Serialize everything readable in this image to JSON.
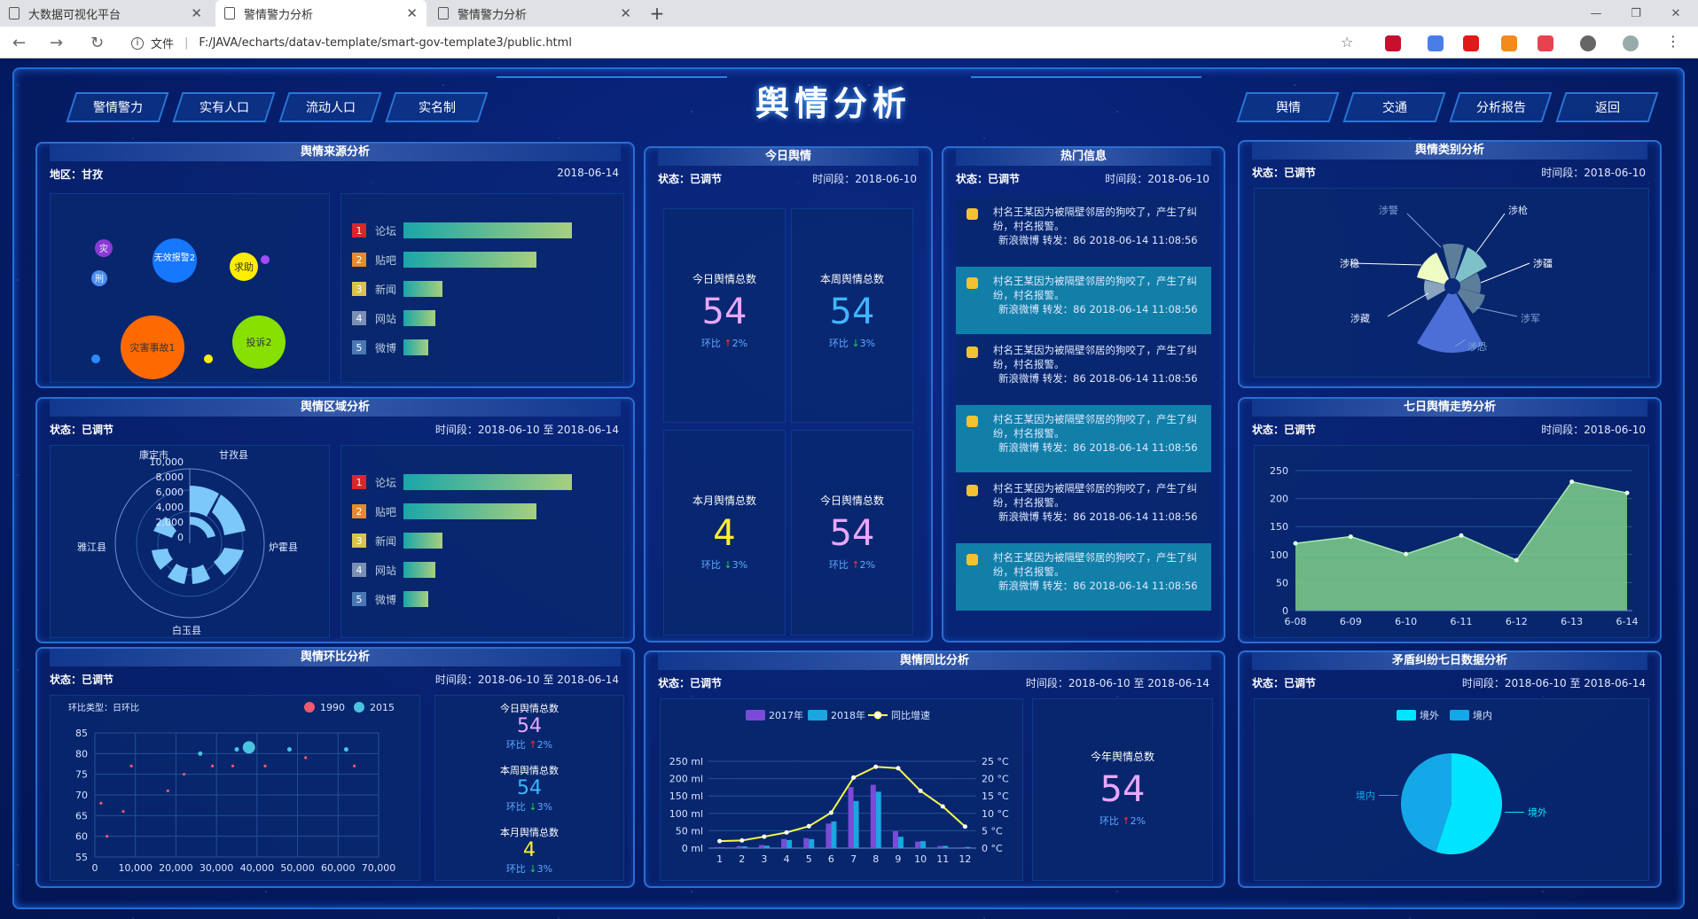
{
  "browser": {
    "tabs": [
      {
        "label": "大数据可视化平台"
      },
      {
        "label": "警情警力分析"
      },
      {
        "label": "警情警力分析"
      }
    ],
    "file_label": "文件",
    "url": "F:/JAVA/echarts/datav-template/smart-gov-template3/public.html"
  },
  "page": {
    "title": "舆情分析",
    "nav_left": [
      "警情警力",
      "实有人口",
      "流动人口",
      "实名制"
    ],
    "nav_right": [
      "舆情",
      "交通",
      "分析报告",
      "返回"
    ]
  },
  "source_panel": {
    "title": "舆情来源分析",
    "region": "地区：甘孜",
    "date": "2018-06-14",
    "bubbles": [
      {
        "label": "灾",
        "color": "#8a3bd6"
      },
      {
        "label": "无效报警2",
        "color": "#1677ff"
      },
      {
        "label": "求助",
        "color": "#ffee00"
      },
      {
        "label": "刑",
        "color": "#4e8ef5"
      },
      {
        "label": "灾害事故1",
        "color": "#ff6a00"
      },
      {
        "label": "投诉2",
        "color": "#88e000"
      }
    ],
    "ranks": [
      {
        "rank": "1",
        "name": "论坛",
        "value": 0.95,
        "color": "#d8262d"
      },
      {
        "rank": "2",
        "name": "贴吧",
        "value": 0.75,
        "color": "#e88a2a"
      },
      {
        "rank": "3",
        "name": "新闻",
        "value": 0.22,
        "color": "#d8c44a"
      },
      {
        "rank": "4",
        "name": "网站",
        "value": 0.18,
        "color": "#7a8fb5"
      },
      {
        "rank": "5",
        "name": "微博",
        "value": 0.14,
        "color": "#4a78b5"
      }
    ]
  },
  "region_panel": {
    "title": "舆情区域分析",
    "status": "状态：已调节",
    "period": "时间段：2018-06-10 至 2018-06-14",
    "radial_labels": [
      "康定市",
      "甘孜县",
      "雅江县",
      "炉霍县",
      "白玉县"
    ],
    "radial_ticks": [
      "10,000",
      "8,000",
      "6,000",
      "4,000",
      "2,000",
      "0"
    ],
    "ranks": [
      {
        "rank": "1",
        "name": "论坛",
        "value": 0.95,
        "color": "#d8262d"
      },
      {
        "rank": "2",
        "name": "贴吧",
        "value": 0.75,
        "color": "#e88a2a"
      },
      {
        "rank": "3",
        "name": "新闻",
        "value": 0.22,
        "color": "#d8c44a"
      },
      {
        "rank": "4",
        "name": "网站",
        "value": 0.18,
        "color": "#7a8fb5"
      },
      {
        "rank": "5",
        "name": "微博",
        "value": 0.14,
        "color": "#4a78b5"
      }
    ]
  },
  "today_panel": {
    "title": "今日舆情",
    "status": "状态：已调节",
    "period": "时间段：2018-06-10",
    "stats": [
      {
        "label": "今日舆情总数",
        "value": "54",
        "ratio_label": "环比",
        "arrow": "↑",
        "ratio": "2%",
        "color": "#e9a7ff"
      },
      {
        "label": "本周舆情总数",
        "value": "54",
        "ratio_label": "环比",
        "arrow": "↓",
        "ratio": "3%",
        "color": "#3fb6ff"
      },
      {
        "label": "本月舆情总数",
        "value": "4",
        "ratio_label": "环比",
        "arrow": "↓",
        "ratio": "3%",
        "color": "#ffee33"
      },
      {
        "label": "今日舆情总数",
        "value": "54",
        "ratio_label": "环比",
        "arrow": "↑",
        "ratio": "2%",
        "color": "#e9a7ff"
      }
    ]
  },
  "hot_panel": {
    "title": "热门信息",
    "status": "状态：已调节",
    "period": "时间段：2018-06-10",
    "items": [
      {
        "text": "村名王某因为被隔壁邻居的狗咬了，产生了纠纷，村名报警。",
        "meta": "新浪微博 转发：86 2018-06-14 11:08:56"
      },
      {
        "text": "村名王某因为被隔壁邻居的狗咬了，产生了纠纷，村名报警。",
        "meta": "新浪微博 转发：86 2018-06-14 11:08:56"
      },
      {
        "text": "村名王某因为被隔壁邻居的狗咬了，产生了纠纷，村名报警。",
        "meta": "新浪微博 转发：86 2018-06-14 11:08:56"
      },
      {
        "text": "村名王某因为被隔壁邻居的狗咬了，产生了纠纷，村名报警。",
        "meta": "新浪微博 转发：86 2018-06-14 11:08:56"
      },
      {
        "text": "村名王某因为被隔壁邻居的狗咬了，产生了纠纷，村名报警。",
        "meta": "新浪微博 转发：86 2018-06-14 11:08:56"
      },
      {
        "text": "村名王某因为被隔壁邻居的狗咬了，产生了纠纷，村名报警。",
        "meta": "新浪微博 转发：86 2018-06-14 11:08:56"
      }
    ]
  },
  "type_panel": {
    "title": "舆情类别分析",
    "status": "状态：已调节",
    "period": "时间段：2018-06-10",
    "labels": [
      "涉警",
      "涉稳",
      "涉藏",
      "涉枪",
      "涉疆",
      "涉军",
      "涉恐"
    ]
  },
  "trend_panel": {
    "title": "七日舆情走势分析",
    "status": "状态：已调节",
    "period": "时间段：2018-06-10"
  },
  "ring_panel": {
    "title": "舆情环比分析",
    "status": "状态：已调节",
    "period": "时间段：2018-06-10 至 2018-06-14",
    "ring_type": "环比类型：日环比",
    "stats": [
      {
        "label": "今日舆情总数",
        "value": "54",
        "ratio_label": "环比",
        "arrow": "↑",
        "ratio": "2%",
        "color": "#e9a7ff"
      },
      {
        "label": "本周舆情总数",
        "value": "54",
        "ratio_label": "环比",
        "arrow": "↓",
        "ratio": "3%",
        "color": "#3fb6ff"
      },
      {
        "label": "本月舆情总数",
        "value": "4",
        "ratio_label": "环比",
        "arrow": "↓",
        "ratio": "3%",
        "color": "#ffee33"
      }
    ]
  },
  "yoy_panel": {
    "title": "舆情同比分析",
    "status": "状态：已调节",
    "period": "时间段：2018-06-10 至 2018-06-14",
    "year_stat": {
      "label": "今年舆情总数",
      "value": "54",
      "ratio_label": "环比",
      "arrow": "↑",
      "ratio": "2%"
    }
  },
  "dispute_panel": {
    "title": "矛盾纠纷七日数据分析",
    "status": "状态：已调节",
    "period": "时间段：2018-06-10 至 2018-06-14"
  },
  "chart_data": [
    {
      "type": "line",
      "title": "七日舆情走势分析",
      "categories": [
        "6-08",
        "6-09",
        "6-10",
        "6-11",
        "6-12",
        "6-13",
        "6-14"
      ],
      "series": [
        {
          "values": [
            120,
            132,
            101,
            134,
            90,
            230,
            210
          ]
        }
      ],
      "ylim": [
        0,
        250
      ],
      "yticks": [
        0,
        50,
        100,
        150,
        200,
        250
      ],
      "fill": "area",
      "color": "#7fd18a"
    },
    {
      "type": "scatter",
      "title": "舆情环比分析",
      "xlim": [
        0,
        70000
      ],
      "ylim": [
        55,
        85
      ],
      "xticks": [
        "0",
        "10,000",
        "20,000",
        "30,000",
        "40,000",
        "50,000",
        "60,000",
        "70,000"
      ],
      "yticks": [
        55,
        60,
        65,
        70,
        75,
        80,
        85
      ],
      "series": [
        {
          "name": "1990",
          "color": "#f05a6e",
          "points": [
            [
              1500,
              68
            ],
            [
              7000,
              66
            ],
            [
              9000,
              77
            ],
            [
              18000,
              71
            ],
            [
              22000,
              75
            ],
            [
              29000,
              77
            ],
            [
              34000,
              77
            ],
            [
              42000,
              77
            ],
            [
              52000,
              79
            ],
            [
              64000,
              77
            ],
            [
              3000,
              60
            ]
          ]
        },
        {
          "name": "2015",
          "color": "#4ac3e0",
          "points": [
            [
              35000,
              81
            ],
            [
              38000,
              81.5
            ],
            [
              48000,
              81
            ],
            [
              62000,
              81
            ],
            [
              26000,
              80
            ]
          ]
        }
      ]
    },
    {
      "type": "bar",
      "title": "舆情同比分析",
      "categories": [
        "1",
        "2",
        "3",
        "4",
        "5",
        "6",
        "7",
        "8",
        "9",
        "10",
        "11",
        "12"
      ],
      "series": [
        {
          "name": "2017年",
          "values": [
            2.6,
            5.9,
            9.0,
            26.4,
            28.7,
            70.7,
            175.6,
            182.2,
            48.7,
            18.8,
            6.0,
            2.3
          ],
          "color": "#7b4bd8"
        },
        {
          "name": "2018年",
          "values": [
            2.0,
            4.9,
            7.0,
            23.2,
            25.6,
            76.7,
            135.6,
            162.2,
            32.6,
            20.0,
            6.4,
            3.3
          ],
          "color": "#1ba6e0"
        },
        {
          "name": "同比增速",
          "values": [
            2.0,
            2.2,
            3.3,
            4.5,
            6.3,
            10.2,
            20.3,
            23.4,
            23.0,
            16.5,
            12.0,
            6.2
          ],
          "color": "#f7f74a",
          "type": "line"
        }
      ],
      "ylim": [
        0,
        250
      ],
      "yticks": [
        "0 ml",
        "50 ml",
        "100 ml",
        "150 ml",
        "200 ml",
        "250 ml"
      ],
      "y2lim": [
        0,
        25
      ],
      "y2ticks": [
        "0 °C",
        "5 °C",
        "10 °C",
        "15 °C",
        "20 °C",
        "25 °C"
      ]
    },
    {
      "type": "pie",
      "title": "矛盾纠纷七日数据分析",
      "series": [
        {
          "name": "境外",
          "value": 55,
          "color": "#00e5ff"
        },
        {
          "name": "境内",
          "value": 45,
          "color": "#14a8e8"
        }
      ]
    }
  ]
}
